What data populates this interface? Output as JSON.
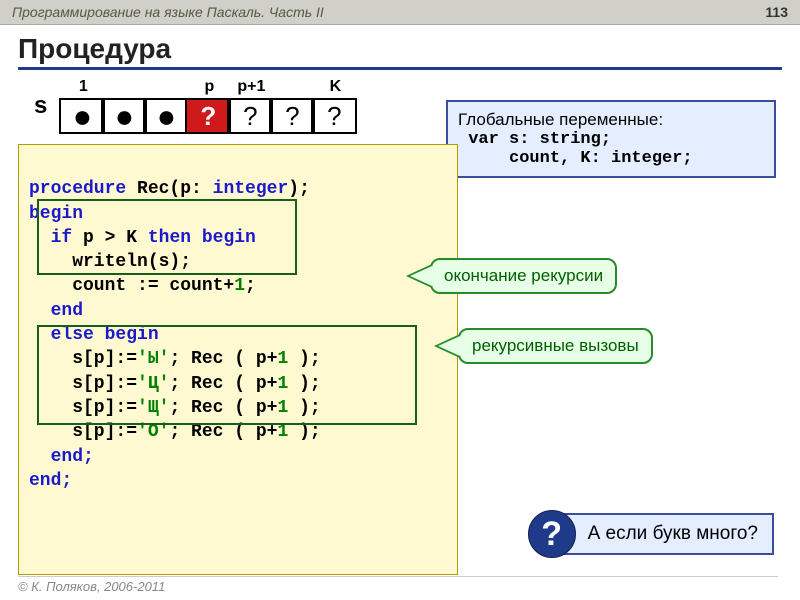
{
  "topbar": {
    "title": "Программирование на языке Паскаль. Часть II",
    "page": "113"
  },
  "heading": "Процедура",
  "array": {
    "label": "s",
    "headers": [
      "1",
      "",
      "",
      "p",
      "p+1",
      "",
      "K"
    ],
    "cells": [
      "●",
      "●",
      "●",
      "?",
      "?",
      "?",
      "?"
    ]
  },
  "globals": {
    "title": "Глобальные переменные:",
    "line1": " var s: string;",
    "line2": "     count, K: integer;"
  },
  "code": {
    "l1a": "procedure",
    "l1b": " Rec(p: ",
    "l1c": "integer",
    "l1d": ");",
    "l2": "begin",
    "l3a": "  if",
    "l3b": " p > K ",
    "l3c": "then begin",
    "l4": "    writeln(s);",
    "l5a": "    count := count+",
    "l5b": "1",
    "l5c": ";",
    "l6": "  end",
    "l7": "  else begin",
    "l8a": "    s[p]:=",
    "l8b": "'Ы'",
    "l8c": "; Rec ( p+",
    "l8d": "1",
    "l8e": " );",
    "l9a": "    s[p]:=",
    "l9b": "'Ц'",
    "l9c": "; Rec ( p+",
    "l9d": "1",
    "l9e": " );",
    "l10a": "    s[p]:=",
    "l10b": "'Щ'",
    "l10c": "; Rec ( p+",
    "l10d": "1",
    "l10e": " );",
    "l11a": "    s[p]:=",
    "l11b": "'О'",
    "l11c": "; Rec ( p+",
    "l11d": "1",
    "l11e": " );",
    "l12": "  end;",
    "l13": "end;"
  },
  "callouts": {
    "c1": "окончание рекурсии",
    "c2": "рекурсивные вызовы"
  },
  "question": {
    "badge": "?",
    "text": "А если букв много?"
  },
  "footer": "© К. Поляков, 2006-2011"
}
